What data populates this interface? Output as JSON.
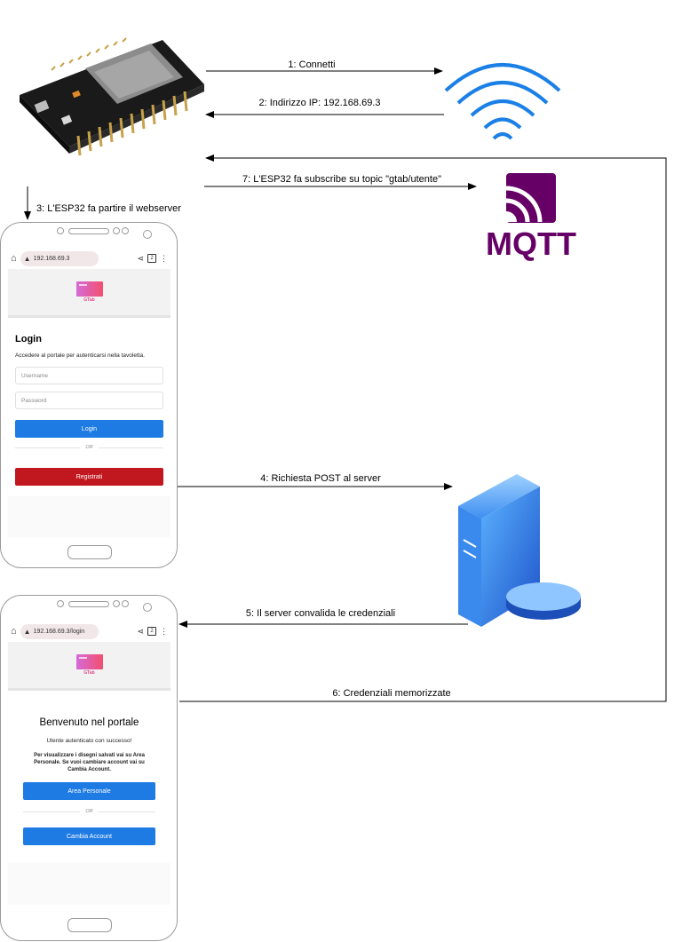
{
  "diagram": {
    "edges": [
      {
        "id": "e1",
        "label": "1: Connetti"
      },
      {
        "id": "e2",
        "label": "2: Indirizzo IP: 192.168.69.3"
      },
      {
        "id": "e3",
        "label": "3: L'ESP32 fa partire il webserver"
      },
      {
        "id": "e4",
        "label": "4: Richiesta POST al server"
      },
      {
        "id": "e5",
        "label": "5: Il server convalida le credenziali"
      },
      {
        "id": "e6",
        "label": "6: Credenziali memorizzate"
      },
      {
        "id": "e7",
        "label": "7: L'ESP32 fa subscribe su topic \"gtab/utente\""
      }
    ],
    "mqtt_logo_text": "MQTT"
  },
  "phone1": {
    "url": "192.168.69.3",
    "tab_count": "2",
    "logo_text": "GTab",
    "title": "Login",
    "subtitle": "Accedere al portale per autenticarsi nella tavoletta.",
    "username_placeholder": "Username",
    "password_placeholder": "Password",
    "login_button": "Login",
    "or_text": "OR",
    "register_button": "Registrati"
  },
  "phone2": {
    "url": "192.168.69.3/login",
    "tab_count": "2",
    "logo_text": "GTab",
    "title": "Benvenuto nel portale",
    "success_text": "Utente autenticato con successo!",
    "info_text": "Per visualizzare i disegni salvati vai su Area Personale. Se vuoi cambiare account vai su Cambia Account.",
    "area_button": "Area Personale",
    "or_text": "OR",
    "switch_button": "Cambia Account"
  },
  "colors": {
    "wifi_blue": "#1a7fe6",
    "mqtt_purple": "#660066",
    "server_blue": "#2b7fe6",
    "login_blue": "#1e7be4",
    "register_red": "#c1171f"
  }
}
